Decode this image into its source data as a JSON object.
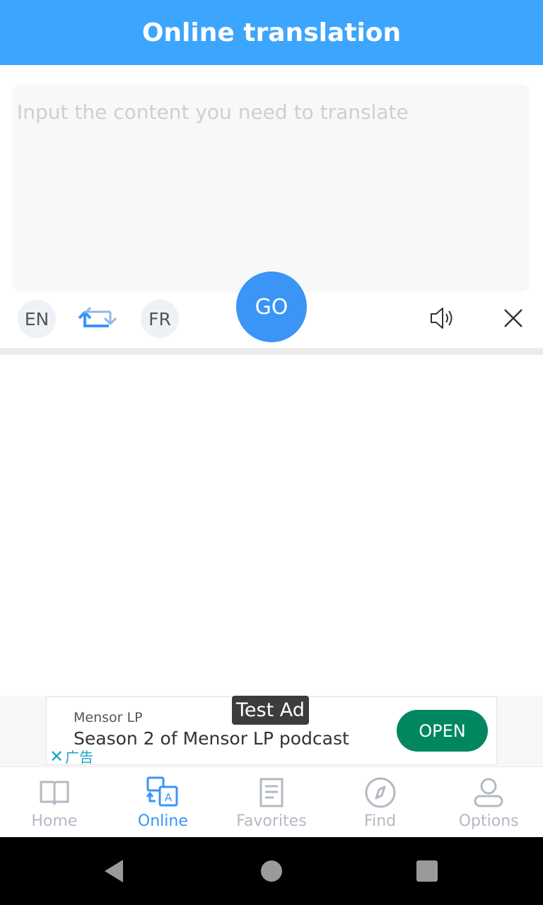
{
  "app_bar": {
    "title": "Online translation"
  },
  "translator": {
    "input_placeholder": "Input the content you need to translate",
    "input_value": "",
    "source_lang": "EN",
    "target_lang": "FR",
    "go_label": "GO",
    "swap_icon": "swap-arrows-icon",
    "speaker_icon": "speaker-icon",
    "clear_icon": "close-icon"
  },
  "ad": {
    "label": "Test Ad",
    "advertiser": "Mensor LP",
    "headline": "Season 2 of Mensor LP podcast",
    "close_label": "广告",
    "cta": "OPEN"
  },
  "bottom_nav": {
    "items": [
      {
        "label": "Home",
        "icon": "book-icon"
      },
      {
        "label": "Online",
        "icon": "translate-icon",
        "active": true
      },
      {
        "label": "Favorites",
        "icon": "document-icon"
      },
      {
        "label": "Find",
        "icon": "compass-icon"
      },
      {
        "label": "Options",
        "icon": "user-icon"
      }
    ]
  },
  "colors": {
    "primary": "#3ca5fd",
    "go_button": "#3a95f6",
    "ad_cta": "#01875f",
    "nav_inactive": "#b3b9c3"
  }
}
